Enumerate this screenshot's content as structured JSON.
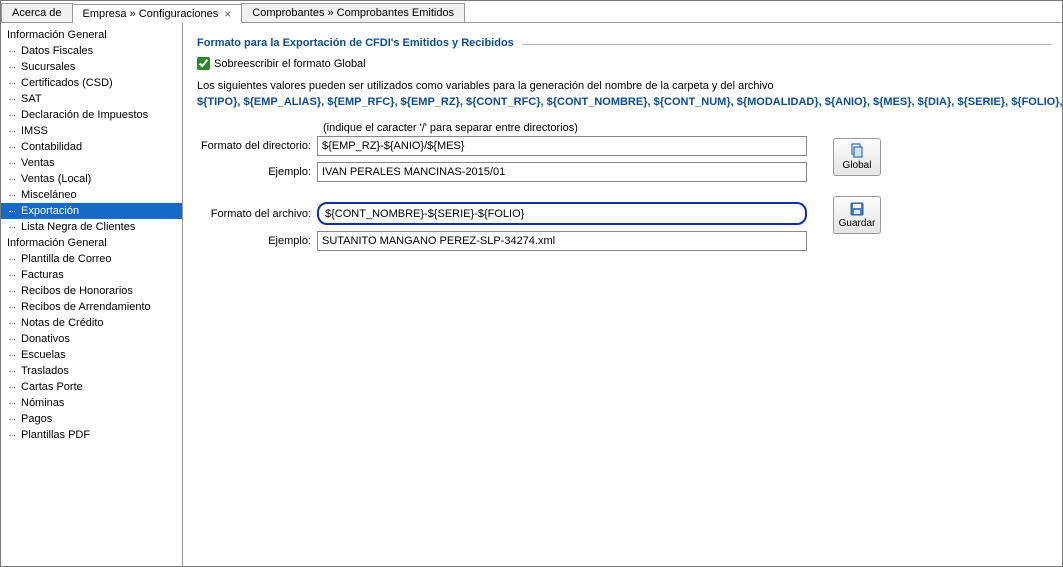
{
  "tabs": [
    {
      "label": "Acerca de",
      "closable": false
    },
    {
      "label": "Empresa » Configuraciones",
      "closable": true
    },
    {
      "label": "Comprobantes » Comprobantes Emitidos",
      "closable": false
    }
  ],
  "sidebar": {
    "group1": {
      "title": "Información General",
      "items": [
        "Datos Fiscales",
        "Sucursales",
        "Certificados (CSD)",
        "SAT",
        "Declaración de Impuestos",
        "IMSS",
        "Contabilidad",
        "Ventas",
        "Ventas (Local)",
        "Misceláneo",
        "Exportación",
        "Lista Negra de Clientes"
      ]
    },
    "group2": {
      "title": "Información General",
      "items": [
        "Plantilla de Correo",
        "Facturas",
        "Recibos de Honorarios",
        "Recibos de Arrendamiento",
        "Notas de Crédito",
        "Donativos",
        "Escuelas",
        "Traslados",
        "Cartas Porte",
        "Nóminas",
        "Pagos",
        "Plantillas PDF"
      ]
    }
  },
  "panel": {
    "title": "Formato para la Exportación de CFDI's Emitidos y Recibidos",
    "overwrite_label": "Sobreescribir el formato Global",
    "overwrite_checked": true,
    "help_text": "Los siguientes valores pueden ser utilizados como variables para la generación del nombre de la carpeta y del archivo",
    "variables": "${TIPO}, ${EMP_ALIAS}, ${EMP_RFC}, ${EMP_RZ}, ${CONT_RFC}, ${CONT_NOMBRE}, ${CONT_NUM}, ${MODALIDAD}, ${ANIO}, ${MES}, ${DIA}, ${SERIE}, ${FOLIO}, ${UUID}",
    "dir_hint": "(indique el caracter '/' para separar entre directorios)",
    "dir_label": "Formato del directorio:",
    "dir_value": "${EMP_RZ}-${ANIO}/${MES}",
    "dir_example_label": "Ejemplo:",
    "dir_example_value": "IVAN PERALES MANCINAS-2015/01",
    "file_label": "Formato del archivo:",
    "file_value": "${CONT_NOMBRE}-${SERIE}-${FOLIO}",
    "file_example_label": "Ejemplo:",
    "file_example_value": "SUTANITO MANGANO PEREZ-SLP-34274.xml",
    "btn_global": "Global",
    "btn_save": "Guardar"
  }
}
